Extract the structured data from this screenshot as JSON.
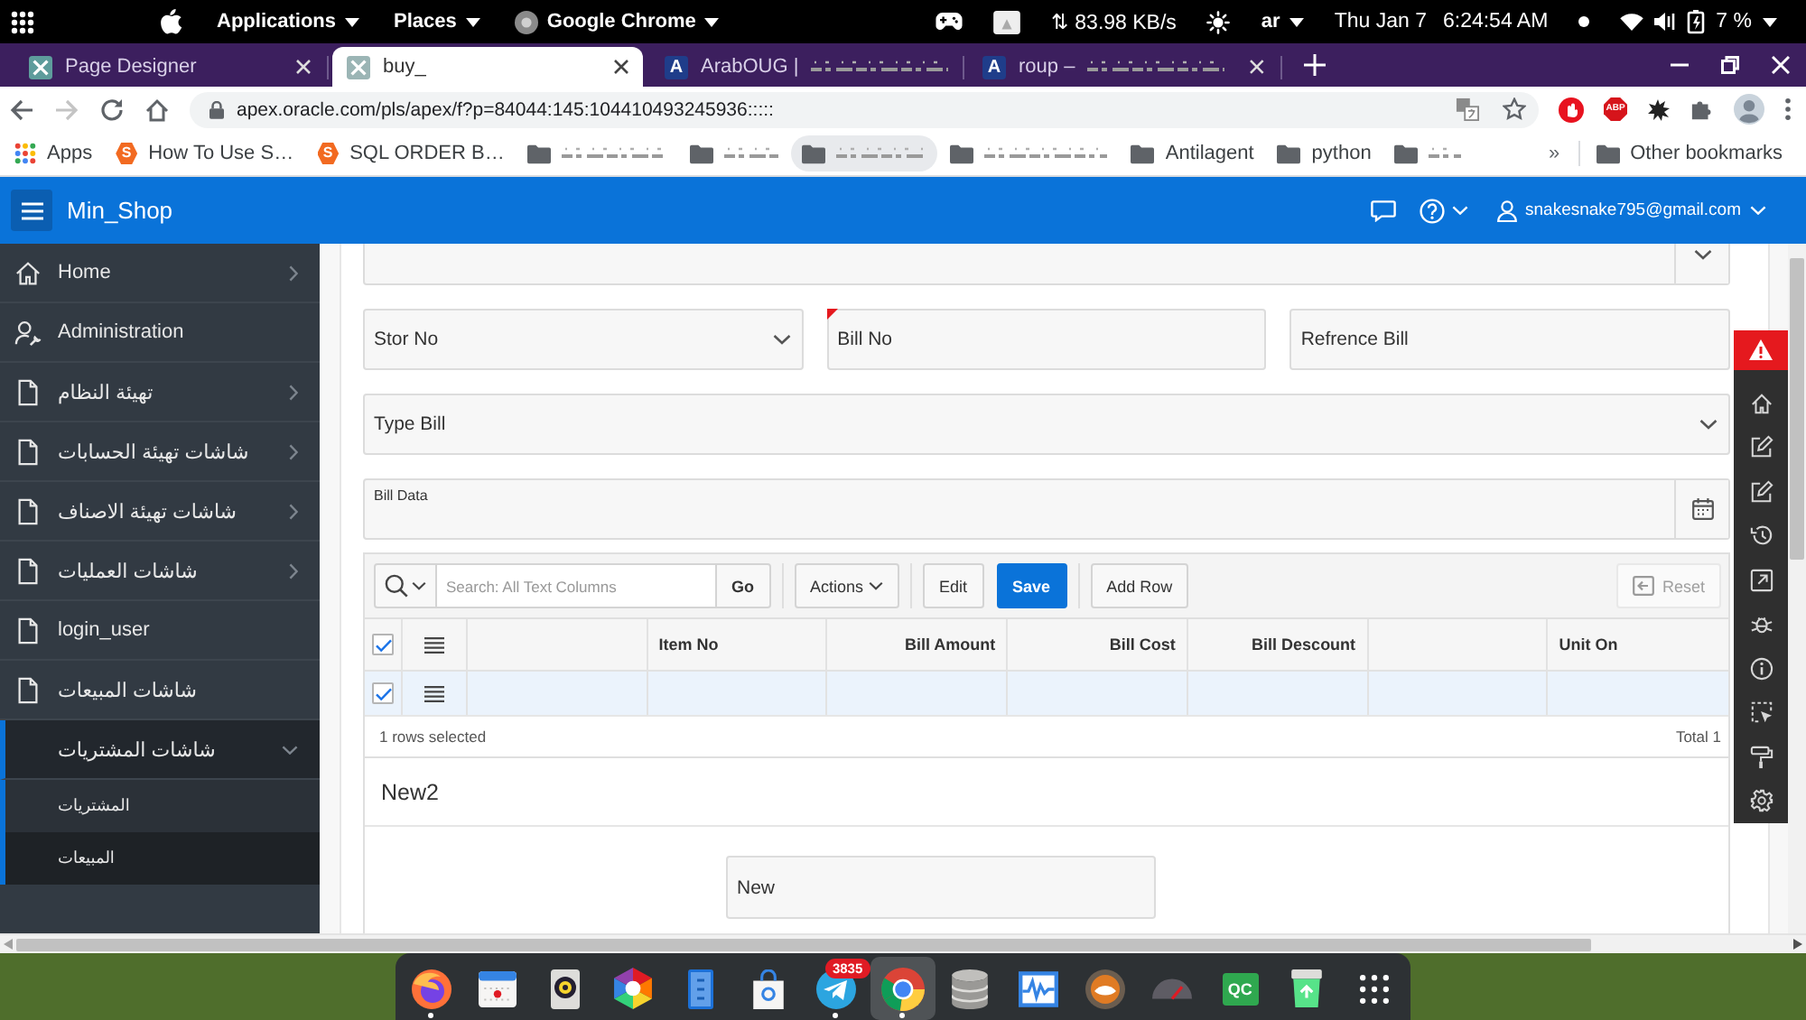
{
  "system_bar": {
    "menus": [
      {
        "kind": "menu",
        "label": "Applications"
      },
      {
        "kind": "menu",
        "label": "Places"
      },
      {
        "kind": "app",
        "label": "Google Chrome"
      }
    ],
    "network": "⇅ 83.98 KB/s",
    "keyboard_layout": "ar",
    "date": "Thu Jan 7",
    "time": "6:24:54 AM",
    "battery": "7 %"
  },
  "browser": {
    "tabs": [
      {
        "kind": "apex",
        "title": "Page Designer",
        "blurred_tail": false,
        "selected": false
      },
      {
        "kind": "apex",
        "title": "buy_",
        "blurred_tail": false,
        "selected": true
      },
      {
        "kind": "letter",
        "favicon_text": "A",
        "title": "ArabOUG |",
        "blurred_tail": true,
        "selected": false
      },
      {
        "kind": "letter",
        "favicon_text": "A",
        "title": "roup –",
        "blurred_tail": true,
        "selected": false
      }
    ],
    "forward_disabled": true,
    "url": "apex.oracle.com/pls/apex/f?p=84044:145:104410493245936:::::",
    "adblock_badge": "ABP",
    "bookmarks": [
      {
        "kind": "apps",
        "label": "Apps",
        "hovered": false
      },
      {
        "kind": "site",
        "favicon_text": "S",
        "label": "How To Use S…",
        "hovered": false
      },
      {
        "kind": "site",
        "favicon_text": "S",
        "label": "SQL ORDER B…",
        "hovered": false
      },
      {
        "kind": "folder",
        "hovered": false
      },
      {
        "kind": "folder",
        "hovered": false
      },
      {
        "kind": "folder",
        "hovered": true
      },
      {
        "kind": "folder",
        "hovered": false
      },
      {
        "kind": "folder",
        "label": "Antilagent",
        "hovered": false
      },
      {
        "kind": "folder",
        "label": "python",
        "hovered": false
      },
      {
        "kind": "folder",
        "hovered": false
      }
    ],
    "bookmarks_overflow": "»",
    "other_bookmarks": "Other bookmarks"
  },
  "apex": {
    "app_title": "Min_Shop",
    "user": "snakesnake795@gmail.com",
    "nav": [
      {
        "kind": "home",
        "label": "Home",
        "expanded": false,
        "selected": false
      },
      {
        "kind": "admin",
        "label": "Administration",
        "selected": false
      },
      {
        "kind": "page",
        "label": "تهيئة النظام",
        "expanded": false,
        "selected": false
      },
      {
        "kind": "page",
        "label": "شاشات تهيئة الحسابات",
        "expanded": false,
        "selected": false
      },
      {
        "kind": "page",
        "label": "شاشات تهيئة الاصناف",
        "expanded": false,
        "selected": false
      },
      {
        "kind": "page",
        "label": "شاشات العمليات",
        "expanded": false,
        "selected": false
      },
      {
        "kind": "page",
        "label": "login_user",
        "selected": false
      },
      {
        "kind": "page",
        "label": "شاشات المبيعات",
        "selected": false
      },
      {
        "kind": "group",
        "label": "شاشات المشتريات",
        "expanded": true,
        "selected": true,
        "children": [
          {
            "kind": "subpage",
            "label": "المشتريات",
            "selected": false
          },
          {
            "kind": "subpage",
            "label": "المبيعات",
            "selected": true
          }
        ]
      }
    ],
    "form": {
      "rows": [
        [
          {
            "kind": "lov",
            "required": false
          }
        ],
        [
          {
            "kind": "select",
            "label": "Stor No",
            "required": false
          },
          {
            "kind": "text",
            "label": "Bill No",
            "required": true
          },
          {
            "kind": "text",
            "label": "Refrence Bill",
            "required": false
          }
        ],
        [
          {
            "kind": "select",
            "label": "Type Bill",
            "required": false
          }
        ],
        [
          {
            "kind": "date",
            "label": "Bill Data",
            "required": false
          }
        ]
      ]
    },
    "grid": {
      "search_placeholder": "Search: All Text Columns",
      "go_button": "Go",
      "button_groups": [
        [
          {
            "kind": "menu",
            "label": "Actions"
          }
        ],
        [
          {
            "kind": "default",
            "label": "Edit"
          },
          {
            "kind": "primary",
            "label": "Save"
          }
        ],
        [
          {
            "kind": "default",
            "label": "Add Row"
          }
        ]
      ],
      "reset": {
        "label": "Reset",
        "disabled": true
      },
      "all_selected": true,
      "columns": [
        {
          "kind": "blank"
        },
        {
          "kind": "text",
          "label": "Item No"
        },
        {
          "kind": "number",
          "label": "Bill Amount"
        },
        {
          "kind": "number",
          "label": "Bill Cost"
        },
        {
          "kind": "number",
          "label": "Bill Descount"
        },
        {
          "kind": "blank"
        },
        {
          "kind": "text",
          "label": "Unit On"
        }
      ],
      "rows": [
        {
          "selected": true
        }
      ],
      "selection_status": "1 rows selected",
      "total": "Total 1"
    },
    "region": {
      "title": "New2",
      "field": {
        "label": "New"
      }
    }
  },
  "dock": {
    "apps": [
      {
        "running": true,
        "selected": false
      },
      {
        "running": false,
        "selected": false
      },
      {
        "running": false,
        "selected": false
      },
      {
        "running": false,
        "selected": false
      },
      {
        "running": false,
        "selected": false
      },
      {
        "running": false,
        "selected": false
      },
      {
        "running": true,
        "selected": false,
        "badge": "3835"
      },
      {
        "running": true,
        "selected": true
      },
      {
        "running": false,
        "selected": false
      },
      {
        "running": false,
        "selected": false
      },
      {
        "running": false,
        "selected": false
      },
      {
        "running": false,
        "selected": false
      },
      {
        "running": false,
        "selected": false,
        "logo_text": "QC"
      },
      {
        "running": false,
        "selected": false
      },
      {
        "running": false,
        "selected": false
      }
    ]
  }
}
